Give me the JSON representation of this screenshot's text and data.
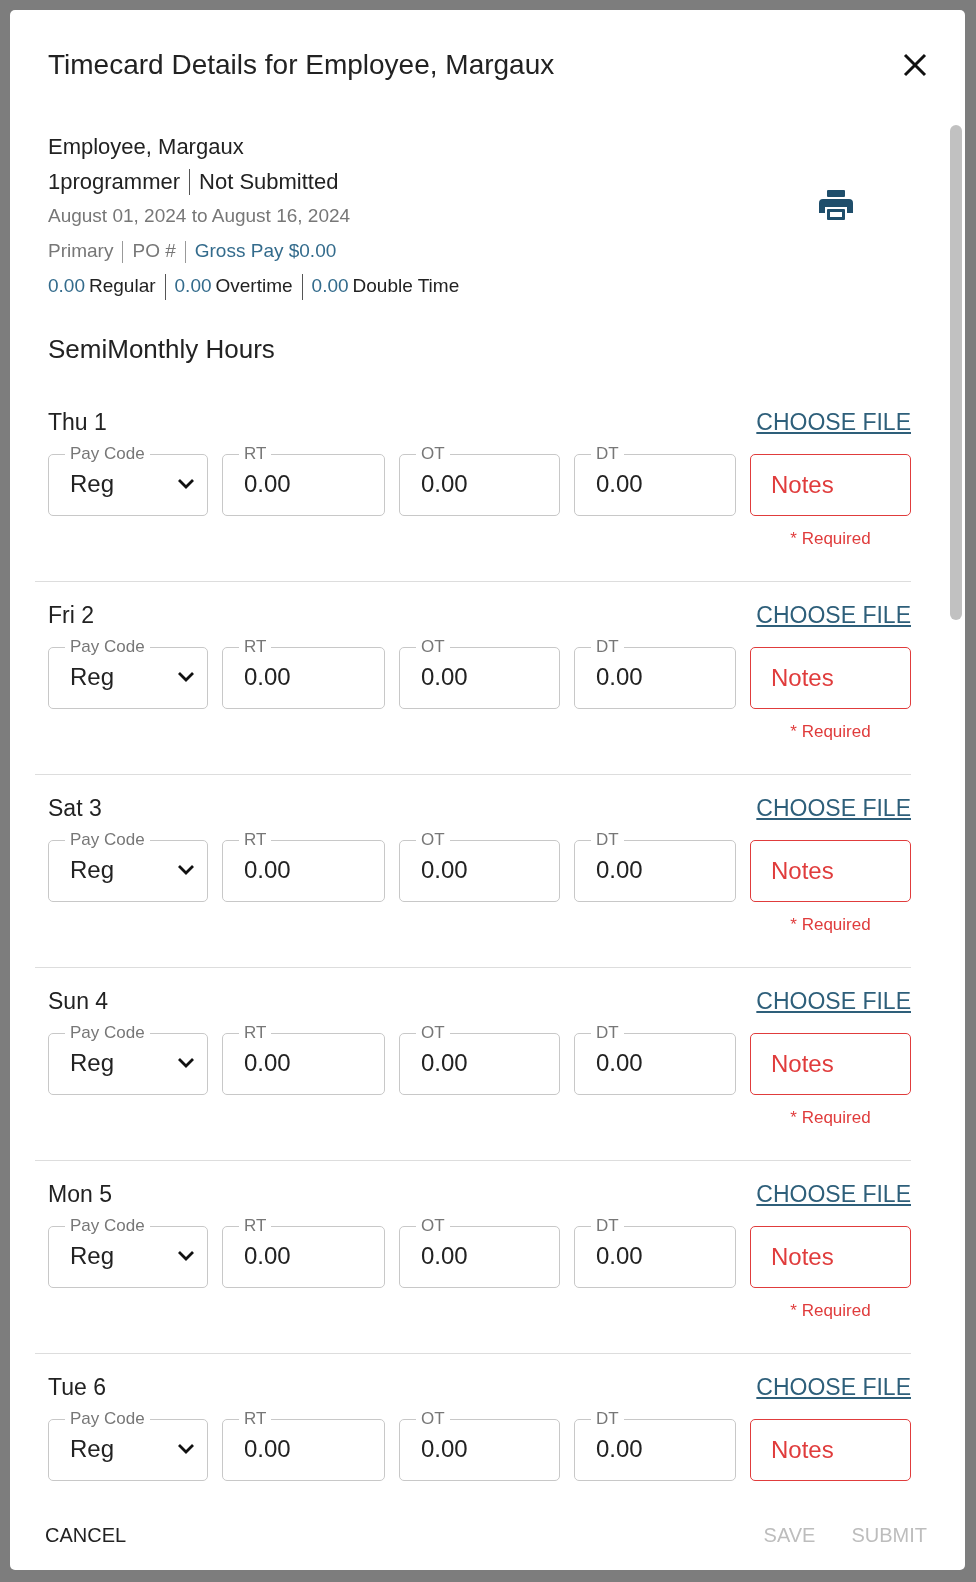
{
  "dialog": {
    "title": "Timecard Details for Employee, Margaux"
  },
  "summary": {
    "employee_name": "Employee, Margaux",
    "position": "1programmer",
    "status": "Not Submitted",
    "period": "August 01, 2024 to August 16, 2024",
    "details": [
      {
        "text": "Primary",
        "highlight": false
      },
      {
        "text": "PO #",
        "highlight": false
      },
      {
        "text": "Gross Pay $0.00",
        "highlight": true
      }
    ],
    "hour_totals": [
      {
        "hours": "0.00",
        "type": "Regular"
      },
      {
        "hours": "0.00",
        "type": "Overtime"
      },
      {
        "hours": "0.00",
        "type": "Double Time"
      }
    ]
  },
  "section_title": "SemiMonthly Hours",
  "days": [
    {
      "label": "Thu 1",
      "choose_file": "CHOOSE FILE",
      "pay_code": {
        "label": "Pay Code",
        "value": "Reg"
      },
      "fields": [
        {
          "label": "RT",
          "value": "0.00"
        },
        {
          "label": "OT",
          "value": "0.00"
        },
        {
          "label": "DT",
          "value": "0.00"
        }
      ],
      "notes": {
        "placeholder": "Notes",
        "invalid": true,
        "error": "* Required"
      }
    },
    {
      "label": "Fri 2",
      "choose_file": "CHOOSE FILE",
      "pay_code": {
        "label": "Pay Code",
        "value": "Reg"
      },
      "fields": [
        {
          "label": "RT",
          "value": "0.00"
        },
        {
          "label": "OT",
          "value": "0.00"
        },
        {
          "label": "DT",
          "value": "0.00"
        }
      ],
      "notes": {
        "placeholder": "Notes",
        "invalid": true,
        "error": "* Required"
      }
    },
    {
      "label": "Sat 3",
      "choose_file": "CHOOSE FILE",
      "pay_code": {
        "label": "Pay Code",
        "value": "Reg"
      },
      "fields": [
        {
          "label": "RT",
          "value": "0.00"
        },
        {
          "label": "OT",
          "value": "0.00"
        },
        {
          "label": "DT",
          "value": "0.00"
        }
      ],
      "notes": {
        "placeholder": "Notes",
        "invalid": true,
        "error": "* Required"
      }
    },
    {
      "label": "Sun 4",
      "choose_file": "CHOOSE FILE",
      "pay_code": {
        "label": "Pay Code",
        "value": "Reg"
      },
      "fields": [
        {
          "label": "RT",
          "value": "0.00"
        },
        {
          "label": "OT",
          "value": "0.00"
        },
        {
          "label": "DT",
          "value": "0.00"
        }
      ],
      "notes": {
        "placeholder": "Notes",
        "invalid": true,
        "error": "* Required"
      }
    },
    {
      "label": "Mon 5",
      "choose_file": "CHOOSE FILE",
      "pay_code": {
        "label": "Pay Code",
        "value": "Reg"
      },
      "fields": [
        {
          "label": "RT",
          "value": "0.00"
        },
        {
          "label": "OT",
          "value": "0.00"
        },
        {
          "label": "DT",
          "value": "0.00"
        }
      ],
      "notes": {
        "placeholder": "Notes",
        "invalid": true,
        "error": "* Required"
      }
    },
    {
      "label": "Tue 6",
      "choose_file": "CHOOSE FILE",
      "pay_code": {
        "label": "Pay Code",
        "value": "Reg"
      },
      "fields": [
        {
          "label": "RT",
          "value": "0.00"
        },
        {
          "label": "OT",
          "value": "0.00"
        },
        {
          "label": "DT",
          "value": "0.00"
        }
      ],
      "notes": {
        "placeholder": "Notes",
        "invalid": true
      }
    }
  ],
  "footer": [
    {
      "label": "CANCEL",
      "disabled": false
    },
    {
      "label": "SAVE",
      "disabled": true
    },
    {
      "label": "SUBMIT",
      "disabled": true
    }
  ]
}
